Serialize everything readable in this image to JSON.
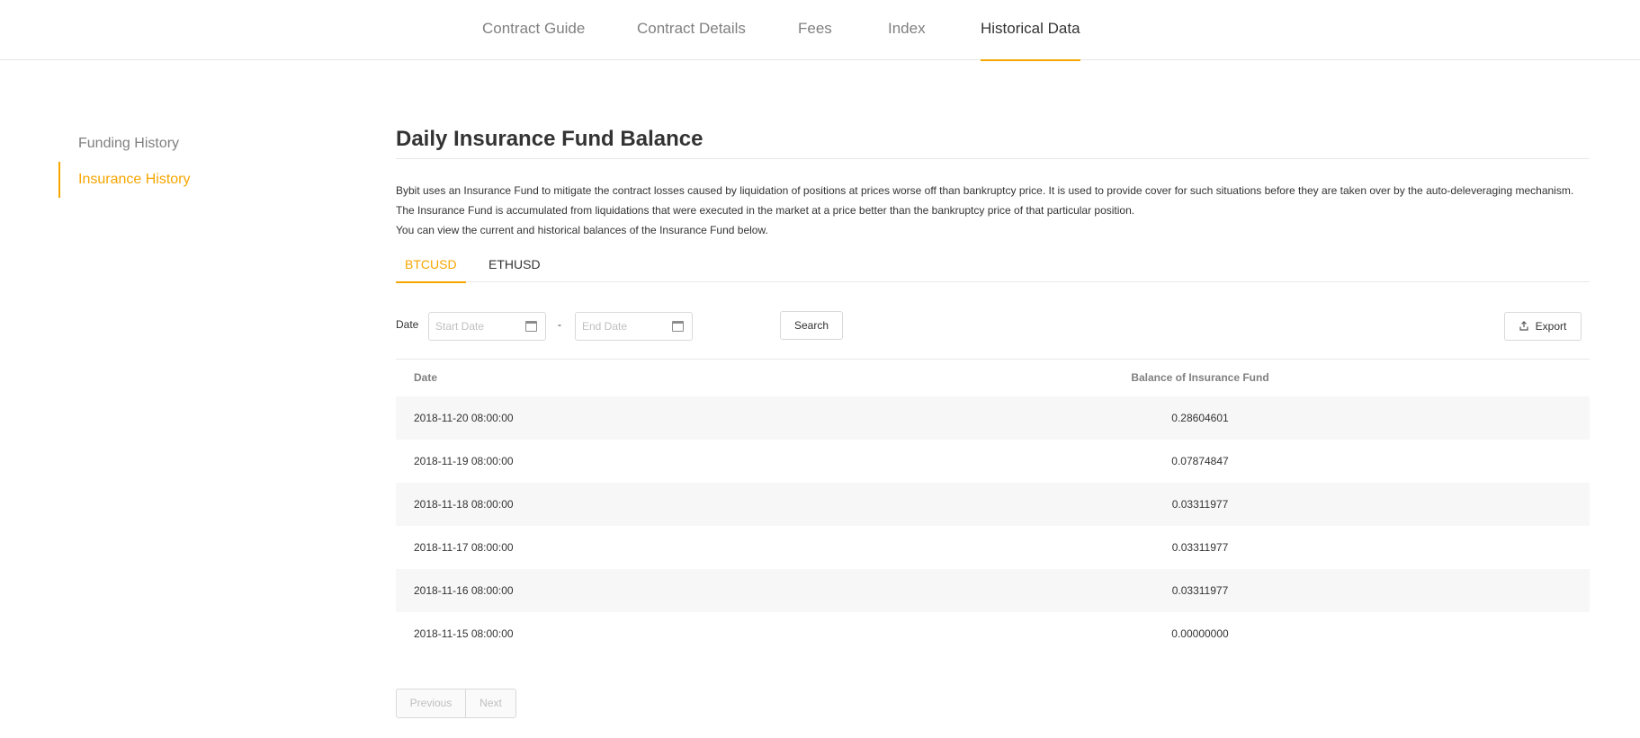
{
  "nav": {
    "tabs": [
      {
        "label": "Contract Guide"
      },
      {
        "label": "Contract Details"
      },
      {
        "label": "Fees"
      },
      {
        "label": "Index"
      },
      {
        "label": "Historical Data"
      }
    ],
    "active_tab": "Historical Data"
  },
  "sidebar": {
    "items": [
      {
        "label": "Funding History"
      },
      {
        "label": "Insurance History"
      }
    ],
    "active_item": "Insurance History"
  },
  "main": {
    "title": "Daily Insurance Fund Balance",
    "description": [
      "Bybit uses an Insurance Fund to mitigate the contract losses caused by liquidation of positions at prices worse off than bankruptcy price. It is used to provide cover for such situations before they are taken over by the auto-deleveraging mechanism.",
      "The Insurance Fund is accumulated from liquidations that were executed in the market at a price better than the bankruptcy price of that particular position.",
      "You can view the current and historical balances of the Insurance Fund below."
    ],
    "subtabs": [
      {
        "label": "BTCUSD"
      },
      {
        "label": "ETHUSD"
      }
    ],
    "active_subtab": "BTCUSD"
  },
  "filters": {
    "date_label": "Date",
    "start_placeholder": "Start Date",
    "end_placeholder": "End Date",
    "separator": "-",
    "search_label": "Search",
    "export_label": "Export"
  },
  "table": {
    "headers": [
      "Date",
      "Balance of Insurance Fund"
    ],
    "rows": [
      [
        "2018-11-20 08:00:00",
        "0.28604601"
      ],
      [
        "2018-11-19 08:00:00",
        "0.07874847"
      ],
      [
        "2018-11-18 08:00:00",
        "0.03311977"
      ],
      [
        "2018-11-17 08:00:00",
        "0.03311977"
      ],
      [
        "2018-11-16 08:00:00",
        "0.03311977"
      ],
      [
        "2018-11-15 08:00:00",
        "0.00000000"
      ]
    ]
  },
  "pagination": {
    "previous_label": "Previous",
    "next_label": "Next"
  },
  "colors": {
    "accent": "#f7a600",
    "text": "#333333",
    "muted": "#808080",
    "row_alt": "#f7f7f7",
    "border": "#e8e8e8"
  }
}
